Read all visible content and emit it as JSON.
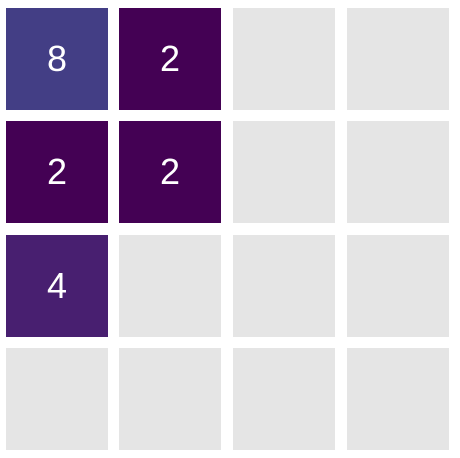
{
  "board": {
    "rows": 4,
    "cols": 4,
    "cells": [
      [
        "8",
        "2",
        "",
        ""
      ],
      [
        "2",
        "2",
        "",
        ""
      ],
      [
        "4",
        "",
        "",
        ""
      ],
      [
        "",
        "",
        "",
        ""
      ]
    ]
  },
  "colors": {
    "empty": "#e5e5e5",
    "text": "#ffffff",
    "tile_2": "#440154",
    "tile_4": "#481f70",
    "tile_8": "#433e85"
  }
}
